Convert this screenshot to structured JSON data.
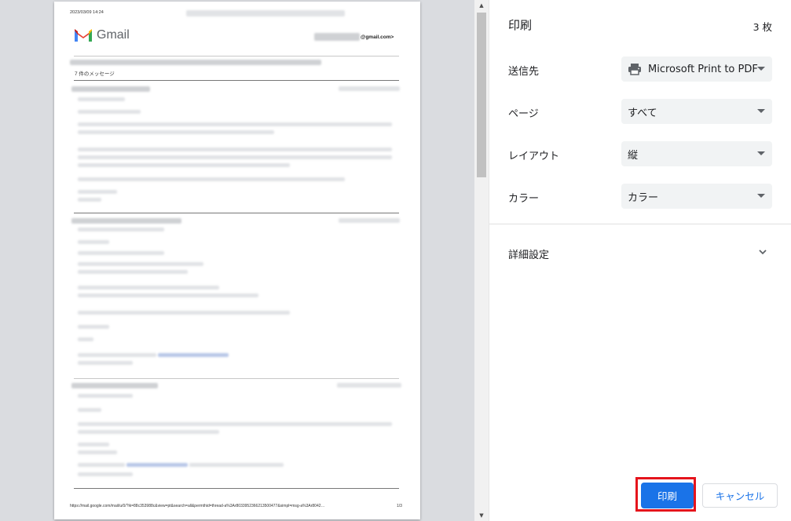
{
  "preview": {
    "header_datetime": "2023/03/09 14:24",
    "logo_text": "Gmail",
    "account_suffix": "@gmail.com>",
    "message_count": "7 件のメッセージ",
    "footer_url": "https://mail.google.com/mail/u/0/?ik=88c353988c&view=pt&search=all&permthid=thread-a%3Ar8033952366213500477&simpl=msg-a%3Ar8042…",
    "page_indicator": "1/3"
  },
  "panel": {
    "title": "印刷",
    "sheet_count": "3 枚",
    "rows": [
      {
        "label": "送信先",
        "value": "Microsoft Print to PDF",
        "icon": "printer-icon"
      },
      {
        "label": "ページ",
        "value": "すべて"
      },
      {
        "label": "レイアウト",
        "value": "縦"
      },
      {
        "label": "カラー",
        "value": "カラー"
      }
    ],
    "more_settings": "詳細設定",
    "print_button": "印刷",
    "cancel_button": "キャンセル"
  },
  "colors": {
    "accent": "#1a73e8",
    "highlight_border": "#e5141c",
    "preview_bg": "#dadce0",
    "select_bg": "#f1f3f4"
  }
}
